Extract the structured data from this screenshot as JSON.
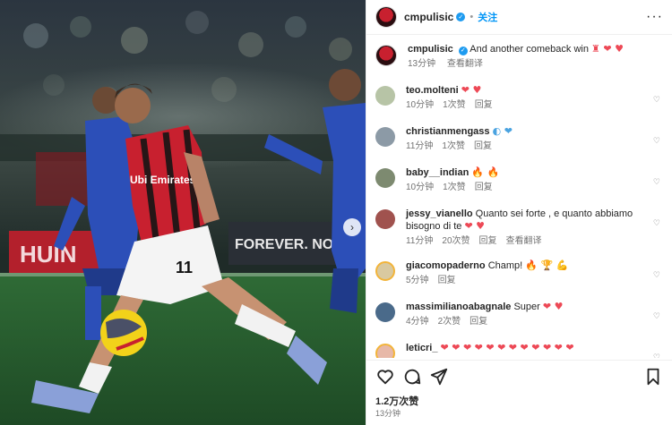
{
  "post": {
    "author": "cmpulisic",
    "follow_label": "关注",
    "more_label": "···",
    "caption": "And another comeback win",
    "caption_emojis": "♜ ❤ ♥",
    "caption_time": "13分钟",
    "caption_translate": "查看翻译",
    "likes": "1.2万次赞",
    "time": "13分钟",
    "slide_arrow": "›"
  },
  "photo": {
    "jersey_sponsor": "Ubi Emirates",
    "jersey_number": "11",
    "board_text": "FOREVER. NOT...",
    "board_left": "HUIN"
  },
  "comments": [
    {
      "user": "teo.molteni",
      "text": "",
      "emojis": "❤ ♥",
      "time": "10分钟",
      "likes": "1次赞",
      "reply": "回复",
      "translate": ""
    },
    {
      "user": "christianmengass",
      "text": "",
      "emojis": "◐ ❤",
      "time": "11分钟",
      "likes": "1次赞",
      "reply": "回复",
      "translate": ""
    },
    {
      "user": "baby__indian",
      "text": "",
      "emojis": "🔥 🔥",
      "time": "10分钟",
      "likes": "1次赞",
      "reply": "回复",
      "translate": ""
    },
    {
      "user": "jessy_vianello",
      "text": "Quanto sei forte , e quanto abbiamo bisogno di te",
      "emojis": "❤ ♥",
      "time": "11分钟",
      "likes": "20次赞",
      "reply": "回复",
      "translate": "查看翻译"
    },
    {
      "user": "giacomopaderno",
      "text": "Champ!",
      "emojis": "🔥 🏆 💪",
      "time": "5分钟",
      "likes": "",
      "reply": "回复",
      "translate": ""
    },
    {
      "user": "massimilianoabagnale",
      "text": "Super",
      "emojis": "❤ ♥",
      "time": "4分钟",
      "likes": "2次赞",
      "reply": "回复",
      "translate": ""
    },
    {
      "user": "leticri_",
      "text": "",
      "emojis": "❤ ❤ ❤ ❤ ❤ ❤ ❤ ❤ ❤ ❤ ❤ ❤",
      "time": "",
      "likes": "",
      "reply": "",
      "translate": ""
    }
  ],
  "icons": [
    "heart-icon",
    "comment-icon",
    "share-icon",
    "save-icon",
    "verified-badge-icon",
    "more-icon"
  ],
  "colors": {
    "accent": "#0095f6",
    "verified": "#1d9bf0",
    "heart": "#ed4956",
    "milan_red": "#c8202f",
    "como_blue": "#2c4fb8"
  }
}
